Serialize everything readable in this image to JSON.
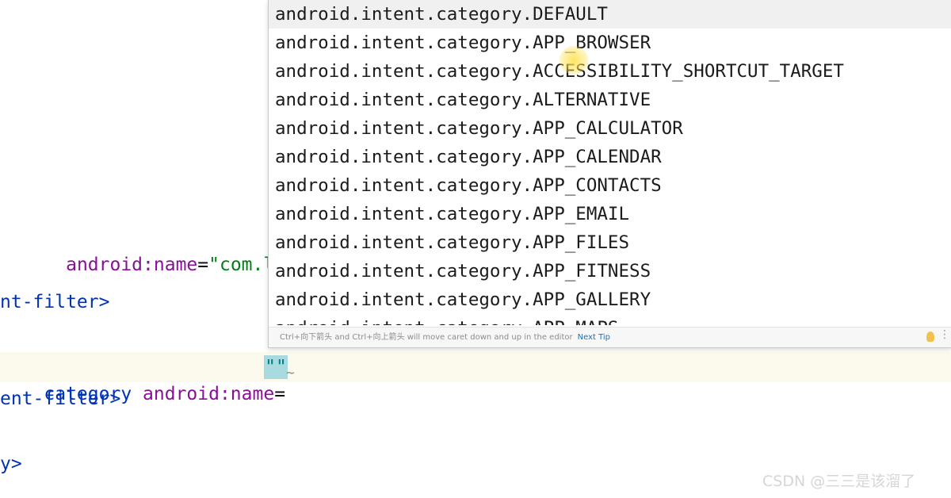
{
  "editor": {
    "line1": {
      "prefix": "  ",
      "attr": "android:name",
      "eq": "=",
      "value": "\"com.ls.a"
    },
    "line2": "nt-filter>",
    "line3": {
      "tag": "category",
      "attr": "android:name",
      "eq": "="
    },
    "caret_char": "\"\"",
    "line4": "ent-filter>",
    "line5": "y>"
  },
  "autocomplete": {
    "items": [
      "android.intent.category.DEFAULT",
      "android.intent.category.APP_BROWSER",
      "android.intent.category.ACCESSIBILITY_SHORTCUT_TARGET",
      "android.intent.category.ALTERNATIVE",
      "android.intent.category.APP_CALCULATOR",
      "android.intent.category.APP_CALENDAR",
      "android.intent.category.APP_CONTACTS",
      "android.intent.category.APP_EMAIL",
      "android.intent.category.APP_FILES",
      "android.intent.category.APP_FITNESS",
      "android.intent.category.APP_GALLERY",
      "android.intent.category.APP_MAPS"
    ],
    "selected_index": 0,
    "footer_hint": "Ctrl+向下箭头 and Ctrl+向上箭头 will move caret down and up in the editor",
    "next_tip": "Next Tip"
  },
  "watermark": "CSDN @三三是该溜了"
}
